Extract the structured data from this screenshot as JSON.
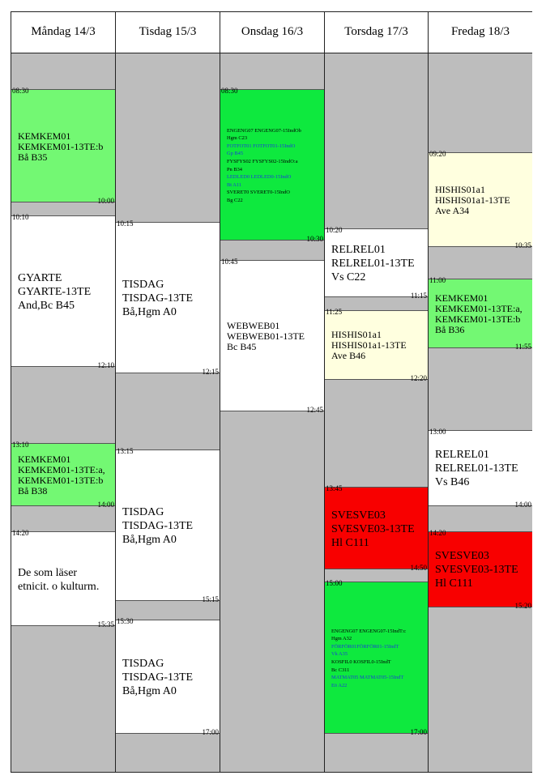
{
  "colors": {
    "green": "#73f873",
    "bright_green": "#0ee93e",
    "white": "#ffffff",
    "cream": "#ffffdf",
    "red": "#f80000",
    "empty": "#bdbdbd"
  },
  "days": [
    {
      "header": "Måndag 14/3",
      "lessons": [
        {
          "start": "08:30",
          "end": "10:00",
          "text": "KEMKEM01\nKEMKEM01-13TE:b\nBå B35",
          "color": "green",
          "size": "med"
        },
        {
          "start": "10:10",
          "end": "12:10",
          "text": "GYARTE\nGYARTE-13TE\nAnd,Bc B45",
          "color": "white",
          "size": "big"
        },
        {
          "start": "13:10",
          "end": "14:00",
          "text": "KEMKEM01\nKEMKEM01-13TE:a,\nKEMKEM01-13TE:b\nBå B38",
          "color": "green",
          "size": "med"
        },
        {
          "start": "14:20",
          "end": "15:35",
          "text": "De som läser\netnicit. o kulturm.",
          "color": "white",
          "size": "big"
        }
      ]
    },
    {
      "header": "Tisdag 15/3",
      "lessons": [
        {
          "start": "10:15",
          "end": "12:15",
          "text": "TISDAG\nTISDAG-13TE\nBå,Hgm A0",
          "color": "white",
          "size": "big"
        },
        {
          "start": "13:15",
          "end": "15:15",
          "text": "TISDAG\nTISDAG-13TE\nBå,Hgm A0",
          "color": "white",
          "size": "big"
        },
        {
          "start": "15:30",
          "end": "17:00",
          "text": "TISDAG\nTISDAG-13TE\nBå,Hgm A0",
          "color": "white",
          "size": "big"
        }
      ]
    },
    {
      "header": "Onsdag 16/3",
      "lessons": [
        {
          "start": "08:30",
          "end": "10:30",
          "color": "bright_green",
          "size": "tiny",
          "lines": [
            {
              "text": "ENGENG07  ENGENG07-15IndOb",
              "blue": false
            },
            {
              "text": "Hgm  C23",
              "blue": false
            },
            {
              "text": "FOTFOT01  FOTFOT01-15IndO",
              "blue": true
            },
            {
              "text": "Gp    B45",
              "blue": true
            },
            {
              "text": "FYSFYS02 FYSFYS02-15IndO:a",
              "blue": false
            },
            {
              "text": "Pn     B34",
              "blue": false
            },
            {
              "text": "LEDLED0   LEDLED0-15IndO",
              "blue": true
            },
            {
              "text": "Bt      A11",
              "blue": true
            },
            {
              "text": "SVERET0  SVERET0-15IndO",
              "blue": false
            },
            {
              "text": "Bg     C22",
              "blue": false
            }
          ]
        },
        {
          "start": "10:45",
          "end": "12:45",
          "text": "WEBWEB01\nWEBWEB01-13TE\nBc  B45",
          "color": "white",
          "size": "med"
        }
      ]
    },
    {
      "header": "Torsdag 17/3",
      "lessons": [
        {
          "start": "10:20",
          "end": "11:15",
          "text": "RELREL01\nRELREL01-13TE\nVs C22",
          "color": "white",
          "size": "big"
        },
        {
          "start": "11:25",
          "end": "12:20",
          "text": "HISHIS01a1\nHISHIS01a1-13TE\nAve  B46",
          "color": "cream",
          "size": "med"
        },
        {
          "start": "13:45",
          "end": "14:50",
          "text": "SVESVE03\nSVESVE03-13TE\nHl  C111",
          "color": "red",
          "size": "big"
        },
        {
          "start": "15:00",
          "end": "17:00",
          "color": "bright_green",
          "size": "tiny",
          "lines": [
            {
              "text": "ENGENG07  ENGENG07-15IndT:c",
              "blue": false
            },
            {
              "text": "Hgm  A32",
              "blue": false
            },
            {
              "text": "FÖRFÖR01FÖRFÖR01-15IndT",
              "blue": true
            },
            {
              "text": "Vk     A35",
              "blue": true
            },
            {
              "text": "KOSFIL0  KOSFIL0-15IndT",
              "blue": false
            },
            {
              "text": "Bc     C311",
              "blue": false
            },
            {
              "text": "MATMAT05  MATMAT05-15IndT",
              "blue": true
            },
            {
              "text": "Eö     A22",
              "blue": true
            }
          ]
        }
      ]
    },
    {
      "header": "Fredag 18/3",
      "lessons": [
        {
          "start": "09:20",
          "end": "10:35",
          "text": "HISHIS01a1\nHISHIS01a1-13TE\nAve  A34",
          "color": "cream",
          "size": "med"
        },
        {
          "start": "11:00",
          "end": "11:55",
          "text": "KEMKEM01\nKEMKEM01-13TE:a,\nKEMKEM01-13TE:b\nBå B36",
          "color": "green",
          "size": "med"
        },
        {
          "start": "13:00",
          "end": "14:00",
          "text": "RELREL01\nRELREL01-13TE\nVs B46",
          "color": "white",
          "size": "big"
        },
        {
          "start": "14:20",
          "end": "15:20",
          "text": "SVESVE03\nSVESVE03-13TE\nHl  C111",
          "color": "red",
          "size": "big"
        }
      ]
    }
  ]
}
